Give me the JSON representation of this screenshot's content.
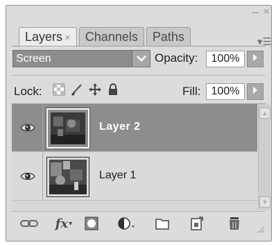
{
  "panel": {
    "tabs": [
      {
        "label": "Layers",
        "active": true,
        "closable": true
      },
      {
        "label": "Channels",
        "active": false
      },
      {
        "label": "Paths",
        "active": false
      }
    ],
    "window_min_icon": "minimize-icon",
    "window_close_icon": "close-icon",
    "panel_menu_icon": "panel-menu-icon"
  },
  "blend_mode": {
    "value": "Screen"
  },
  "opacity": {
    "label": "Opacity:",
    "value": "100%"
  },
  "lock": {
    "label": "Lock:",
    "icons": [
      "lock-transparent-pixels-icon",
      "lock-image-pixels-icon",
      "lock-position-icon",
      "lock-all-icon"
    ]
  },
  "fill": {
    "label": "Fill:",
    "value": "100%"
  },
  "layers": [
    {
      "name": "Layer 2",
      "visible": true,
      "selected": true
    },
    {
      "name": "Layer 1",
      "visible": true,
      "selected": false
    }
  ],
  "toolbar": {
    "icons": [
      "link-layers-icon",
      "layer-style-icon",
      "layer-mask-icon",
      "adjustment-layer-icon",
      "new-group-icon",
      "new-layer-icon",
      "delete-layer-icon"
    ],
    "fx_label": "fx"
  },
  "colors": {
    "selected_row": "#8d8d8d",
    "panel_bg": "#dcdcdc"
  }
}
